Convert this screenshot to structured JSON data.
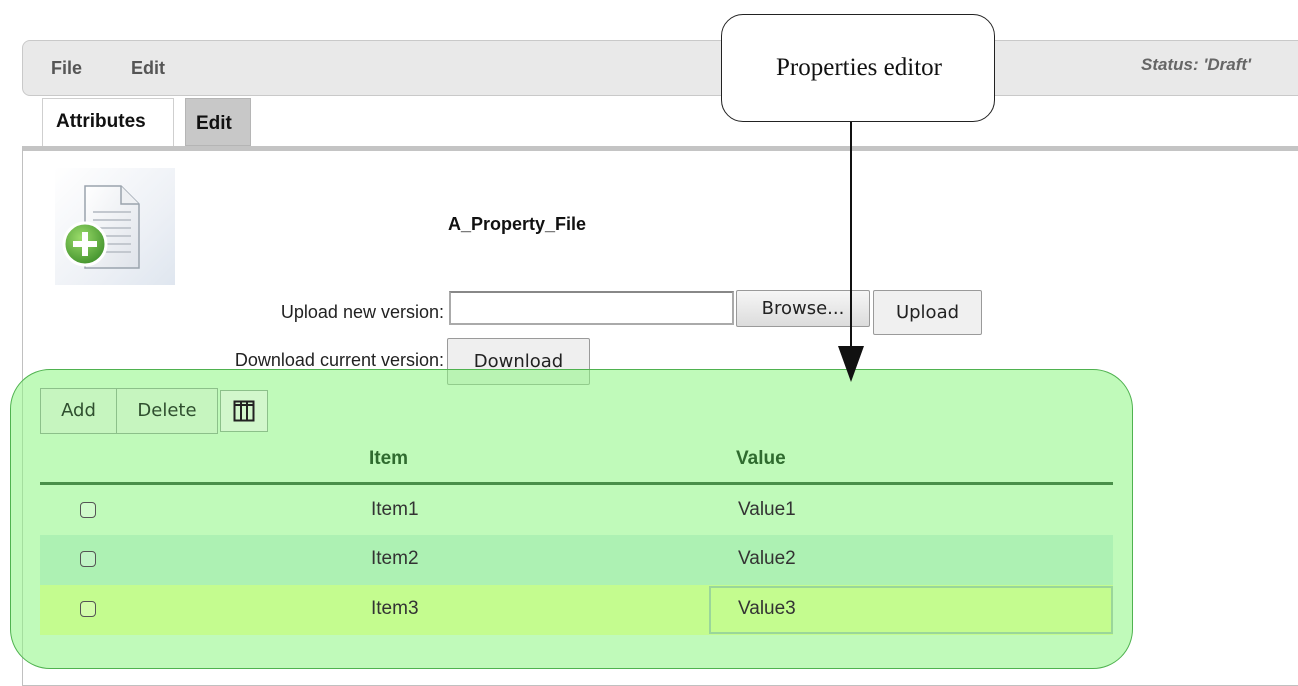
{
  "menubar": {
    "file_label": "File",
    "edit_label": "Edit",
    "status_text": "Status: 'Draft'"
  },
  "tabs": [
    {
      "label": "Attributes",
      "active": false
    },
    {
      "label": "Edit",
      "active": true
    }
  ],
  "document": {
    "icon": "document-add-icon",
    "file_name": "A_Property_File",
    "upload_label": "Upload new version:",
    "upload_value": "",
    "browse_button": "Browse...",
    "upload_button": "Upload",
    "download_label": "Download current version:",
    "download_button": "Download"
  },
  "properties_table": {
    "add_button": "Add",
    "delete_button": "Delete",
    "columns_icon": "columns-icon",
    "columns": [
      "Item",
      "Value"
    ],
    "rows": [
      {
        "item": "Item1",
        "value": "Value1",
        "checked": false
      },
      {
        "item": "Item2",
        "value": "Value2",
        "checked": false
      },
      {
        "item": "Item3",
        "value": "Value3",
        "checked": false,
        "selected": true
      }
    ]
  },
  "callout": {
    "text": "Properties editor"
  },
  "colors": {
    "highlight": "#8cf582",
    "selected_row": "#c4fc8f",
    "header_text": "#2f6b2f"
  }
}
